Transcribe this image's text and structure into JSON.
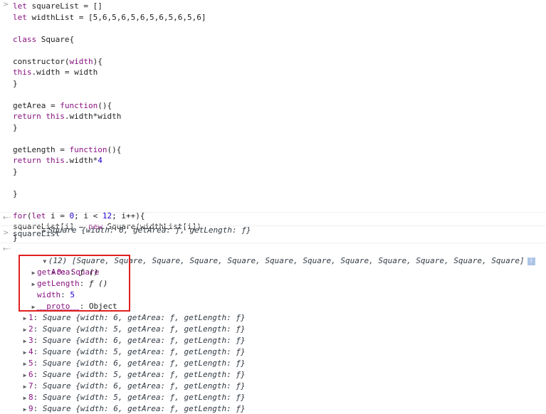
{
  "input": {
    "code_lines": [
      [
        {
          "t": "let",
          "c": "kw"
        },
        {
          "t": " squareList = []",
          "c": "txt"
        }
      ],
      [
        {
          "t": "let",
          "c": "kw"
        },
        {
          "t": " widthList = [5,6,5,6,5,6,5,6,5,6,5,6]",
          "c": "txt"
        }
      ],
      [],
      [
        {
          "t": "class",
          "c": "kw"
        },
        {
          "t": " Square{",
          "c": "txt"
        }
      ],
      [],
      [
        {
          "t": "constructor(",
          "c": "txt"
        },
        {
          "t": "width",
          "c": "kw"
        },
        {
          "t": "){",
          "c": "txt"
        }
      ],
      [
        {
          "t": "this",
          "c": "kw"
        },
        {
          "t": ".width = width",
          "c": "txt"
        }
      ],
      [
        {
          "t": "}",
          "c": "txt"
        }
      ],
      [],
      [
        {
          "t": "getArea = ",
          "c": "txt"
        },
        {
          "t": "function",
          "c": "kw"
        },
        {
          "t": "(){",
          "c": "txt"
        }
      ],
      [
        {
          "t": "return",
          "c": "kw"
        },
        {
          "t": " ",
          "c": "txt"
        },
        {
          "t": "this",
          "c": "kw"
        },
        {
          "t": ".width*width",
          "c": "txt"
        }
      ],
      [
        {
          "t": "}",
          "c": "txt"
        }
      ],
      [],
      [
        {
          "t": "getLength = ",
          "c": "txt"
        },
        {
          "t": "function",
          "c": "kw"
        },
        {
          "t": "(){",
          "c": "txt"
        }
      ],
      [
        {
          "t": "return",
          "c": "kw"
        },
        {
          "t": " ",
          "c": "txt"
        },
        {
          "t": "this",
          "c": "kw"
        },
        {
          "t": ".width*",
          "c": "txt"
        },
        {
          "t": "4",
          "c": "num"
        }
      ],
      [
        {
          "t": "}",
          "c": "txt"
        }
      ],
      [],
      [
        {
          "t": "}",
          "c": "txt"
        }
      ],
      [],
      [
        {
          "t": "for",
          "c": "kw"
        },
        {
          "t": "(",
          "c": "txt"
        },
        {
          "t": "let",
          "c": "kw"
        },
        {
          "t": " i = ",
          "c": "txt"
        },
        {
          "t": "0",
          "c": "num"
        },
        {
          "t": "; i < ",
          "c": "txt"
        },
        {
          "t": "12",
          "c": "num"
        },
        {
          "t": "; i++){",
          "c": "txt"
        }
      ],
      [
        {
          "t": "squareList[i] = ",
          "c": "txt"
        },
        {
          "t": "new",
          "c": "kw"
        },
        {
          "t": " Square(widthList[i])",
          "c": "txt"
        }
      ],
      [
        {
          "t": "}",
          "c": "txt"
        }
      ]
    ]
  },
  "result1": {
    "text": "Square {width: 6, getArea: ƒ, getLength: ƒ}"
  },
  "input2": {
    "text": "squareList"
  },
  "result2": {
    "summary": "(12) [Square, Square, Square, Square, Square, Square, Square, Square, Square, Square, Square, Square]",
    "info_icon": "i",
    "expanded_item": {
      "header": "0: Square",
      "props": [
        {
          "name": "getArea",
          "value": "ƒ ()",
          "expandable": true
        },
        {
          "name": "getLength",
          "value": "ƒ ()",
          "expandable": true
        },
        {
          "name": "width",
          "value": "5",
          "expandable": false
        },
        {
          "name": "__proto__",
          "value": "Object",
          "expandable": true
        }
      ]
    },
    "items": [
      {
        "key": "1",
        "rest": "Square {width: 6, getArea: ƒ, getLength: ƒ}"
      },
      {
        "key": "2",
        "rest": "Square {width: 5, getArea: ƒ, getLength: ƒ}"
      },
      {
        "key": "3",
        "rest": "Square {width: 6, getArea: ƒ, getLength: ƒ}"
      },
      {
        "key": "4",
        "rest": "Square {width: 5, getArea: ƒ, getLength: ƒ}"
      },
      {
        "key": "5",
        "rest": "Square {width: 6, getArea: ƒ, getLength: ƒ}"
      },
      {
        "key": "6",
        "rest": "Square {width: 5, getArea: ƒ, getLength: ƒ}"
      },
      {
        "key": "7",
        "rest": "Square {width: 6, getArea: ƒ, getLength: ƒ}"
      },
      {
        "key": "8",
        "rest": "Square {width: 5, getArea: ƒ, getLength: ƒ}"
      },
      {
        "key": "9",
        "rest": "Square {width: 6, getArea: ƒ, getLength: ƒ}"
      }
    ]
  },
  "icons": {
    "input_prompt": "chevron-right-icon",
    "result_prompt": "return-arrow-icon",
    "expand": "triangle-right-icon",
    "collapse": "triangle-down-icon",
    "info": "info-icon"
  },
  "colors": {
    "keyword": "#881280",
    "number": "#1c00cf",
    "highlight_border": "#e02020"
  }
}
